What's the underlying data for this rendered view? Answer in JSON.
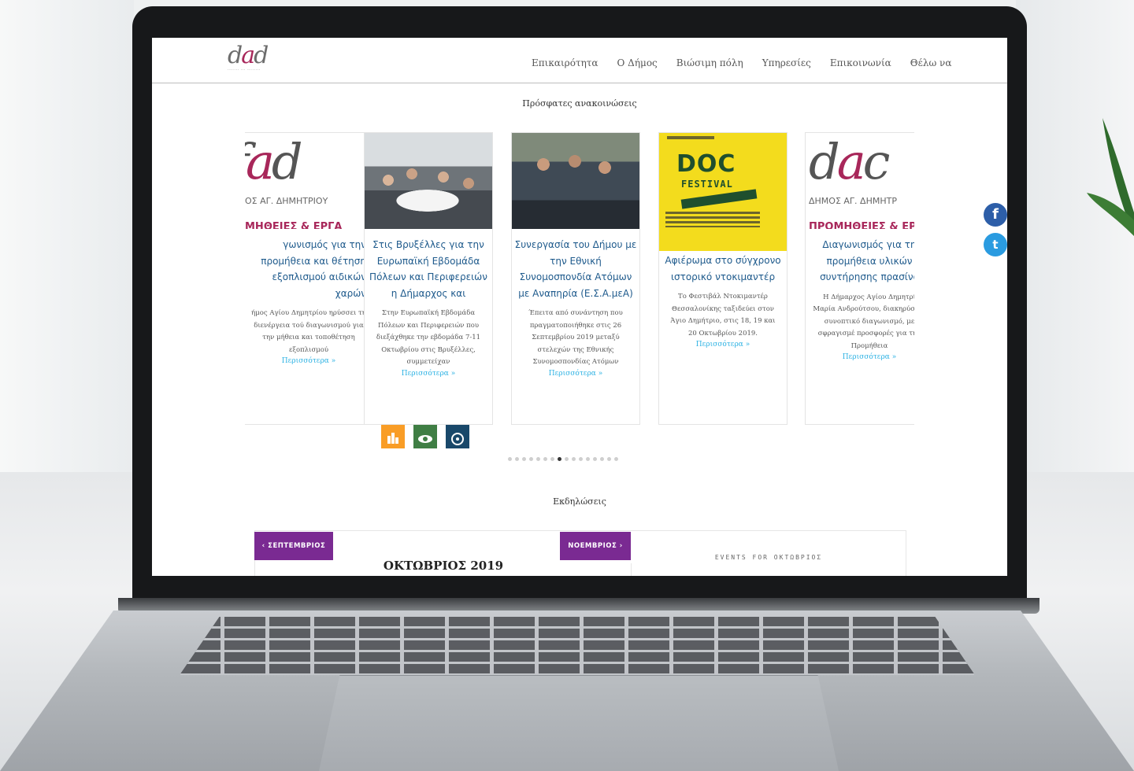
{
  "site": {
    "nav": [
      "Επικαιρότητα",
      "Ο Δήμος",
      "Βιώσιμη πόλη",
      "Υπηρεσίες",
      "Επικοινωνία",
      "Θέλω να"
    ]
  },
  "announcements": {
    "heading": "Πρόσφατες ανακοινώσεις",
    "more_label": "Περισσότερα »",
    "cards": [
      {
        "logo_caption": "ΟΣ ΑΓ. ΔΗΜΗΤΡΙΟΥ",
        "banner": "ΜΗΘΕΙΕΣ & ΕΡΓΑ",
        "title": "γωνισμός για την προμήθεια και θέτηση εξοπλισμού αιδικών χαρών",
        "text": "ήμος Αγίου Δημητρίου ηρύσσει τη διενέργεια τού διαγωνισμού για την μήθεια και τοποθέτηση εξοπλισμού"
      },
      {
        "title": "Στις Βρυξέλλες για την Ευρωπαϊκή Εβδομάδα Πόλεων και Περιφερειών η Δήμαρχος και",
        "text": "Στην Ευρωπαϊκή Εβδομάδα Πόλεων και Περιφερειών που διεξάχθηκε την εβδομάδα 7-11 Οκτωβρίου στις Βρυξέλλες, συμμετείχαν"
      },
      {
        "title": "Συνεργασία του Δήμου με την Εθνική Συνομοσπονδία Ατόμων με Αναπηρία (Ε.Σ.Α.μεΑ)",
        "text": "Έπειτα από συνάντηση που πραγματοποιήθηκε στις 26 Σεπτεμβρίου 2019 μεταξύ στελεχών της Εθνικής Συνομοσπονδίας Ατόμων"
      },
      {
        "poster_title": "DOC",
        "poster_subtitle": "FESTIVAL",
        "title": "Αφιέρωμα στο σύγχρονο ιστορικό ντοκιμαντέρ",
        "text": "Το Φεστιβάλ Ντοκιμαντέρ Θεσσαλονίκης ταξιδεύει στον Άγιο Δημήτριο, στις 18, 19 και 20 Οκτωβρίου 2019."
      },
      {
        "logo_caption": "ΔΗΜΟΣ ΑΓ. ΔΗΜΗΤΡ",
        "banner": "ΠΡΟΜΗΘΕΙΕΣ & ΕΡ",
        "title": "Διαγωνισμός για τη προμήθεια υλικών συντήρησης πρασίνο",
        "text": "Η Δήμαρχος Αγίου Δημητρί Μαρία Ανδρούτσου, διακηρύσσει συνοπτικό διαγωνισμό, με σφραγισμέ προσφορές για την Προμήθεια"
      }
    ],
    "sdg_colors": [
      "#f99d26",
      "#3f7e44",
      "#19486a"
    ],
    "pager": {
      "count": 16,
      "active": 7
    }
  },
  "social": {
    "facebook": "f",
    "twitter": "t"
  },
  "events": {
    "heading": "Εκδηλώσεις",
    "prev_month": "‹ ΣΕΠΤΕΜΒΡΙΟΣ",
    "next_month": "ΝΟΕΜΒΡΙΟΣ ›",
    "month_title": "ΟΚΤΩΒΡΙΟΣ 2019",
    "events_for": "EVENTS FOR ΟΚΤΩΒΡΙΟΣ"
  },
  "colors": {
    "accent_purple": "#7a2a92",
    "link_blue": "#2ab1e3",
    "title_blue": "#1e5a8c",
    "brand_magenta": "#a8275a"
  }
}
